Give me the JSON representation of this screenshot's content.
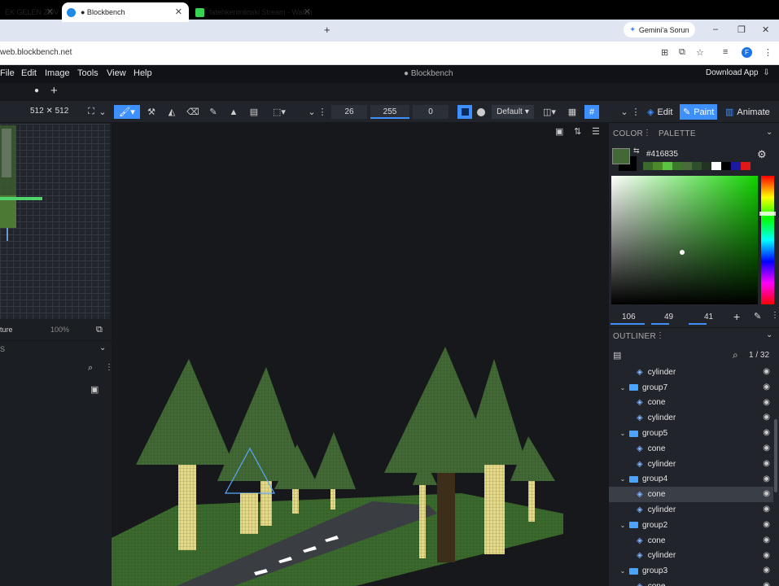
{
  "browser": {
    "tabs": [
      {
        "label": "EK GELEN ZOV",
        "active": false
      },
      {
        "label": "● Blockbench",
        "active": true
      },
      {
        "label": "fatehkerimlinski Stream - Watch",
        "active": false
      }
    ],
    "new_tab": "+",
    "gemini_label": "Gemini'a Sorun",
    "url": "web.blockbench.net",
    "profile_initial": "F"
  },
  "app": {
    "title": "● Blockbench",
    "menu": [
      "File",
      "Edit",
      "Image",
      "Tools",
      "View",
      "Help"
    ],
    "download_label": "Download App",
    "tab_dot": "●",
    "tab_plus": "+"
  },
  "toolbar": {
    "resolution": "512 ✕ 512",
    "brush_size": "26",
    "opacity": "255",
    "softness": "0",
    "blend_mode": "Default",
    "modes": {
      "edit": "Edit",
      "paint": "Paint",
      "animate": "Animate"
    }
  },
  "left_panel": {
    "texture_label": "ture",
    "zoom": "100%",
    "section_label": "S"
  },
  "color_panel": {
    "tab_color": "COLOR",
    "tab_palette": "PALETTE",
    "hex": "#416835",
    "r": "106",
    "g": "49",
    "b": "41",
    "accent": "#3e90ff",
    "current_color": "#416835",
    "recent_swatches": [
      "#3a6b2a",
      "#4c8a2c",
      "#5ec241",
      "#3b7a2a",
      "#4a6b3a",
      "#2f4f2a",
      "#223322",
      "#ffffff",
      "#000000",
      "#1a1aa0",
      "#e01818"
    ]
  },
  "outliner": {
    "title": "OUTLINER",
    "counter": "1 / 32",
    "items": [
      {
        "label": "cylinder",
        "type": "mesh",
        "depth": 1,
        "selected": false
      },
      {
        "label": "group7",
        "type": "group",
        "depth": 0,
        "selected": false
      },
      {
        "label": "cone",
        "type": "mesh",
        "depth": 1,
        "selected": false
      },
      {
        "label": "cylinder",
        "type": "mesh",
        "depth": 1,
        "selected": false
      },
      {
        "label": "group5",
        "type": "group",
        "depth": 0,
        "selected": false
      },
      {
        "label": "cone",
        "type": "mesh",
        "depth": 1,
        "selected": false
      },
      {
        "label": "cylinder",
        "type": "mesh",
        "depth": 1,
        "selected": false
      },
      {
        "label": "group4",
        "type": "group",
        "depth": 0,
        "selected": false
      },
      {
        "label": "cone",
        "type": "mesh",
        "depth": 1,
        "selected": true
      },
      {
        "label": "cylinder",
        "type": "mesh",
        "depth": 1,
        "selected": false
      },
      {
        "label": "group2",
        "type": "group",
        "depth": 0,
        "selected": false
      },
      {
        "label": "cone",
        "type": "mesh",
        "depth": 1,
        "selected": false
      },
      {
        "label": "cylinder",
        "type": "mesh",
        "depth": 1,
        "selected": false
      },
      {
        "label": "group3",
        "type": "group",
        "depth": 0,
        "selected": false
      },
      {
        "label": "cone",
        "type": "mesh",
        "depth": 1,
        "selected": false
      }
    ]
  }
}
